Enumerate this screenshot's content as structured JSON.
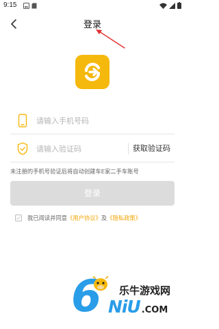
{
  "status_bar": {
    "time": "9:15"
  },
  "header": {
    "title": "登录"
  },
  "form": {
    "phone_placeholder": "请输入手机号码",
    "code_placeholder": "请输入验证码",
    "get_code_label": "获取验证码"
  },
  "register_note": "未注册的手机号验证后将自动创建车E家二手车账号",
  "login_button_label": "登录",
  "agreement": {
    "prefix": "我已阅读并同意",
    "user_agreement": "《用户协议》",
    "conjunction": "及",
    "privacy_policy": "《隐私政策》",
    "checked": false
  },
  "watermark": {
    "digit": "6",
    "name_cn": "乐牛游戏网",
    "domain_main": "NiU",
    "domain_suffix": ".COM"
  },
  "colors": {
    "accent": "#f5b80c",
    "link": "#f0a500",
    "button_disabled": "#dcdcdc",
    "annotation_arrow": "#e03030",
    "watermark_blue": "#2a9de8"
  },
  "icons": [
    "back-arrow-icon",
    "phone-icon",
    "shield-check-icon",
    "checkbox-icon",
    "app-logo-icon"
  ]
}
